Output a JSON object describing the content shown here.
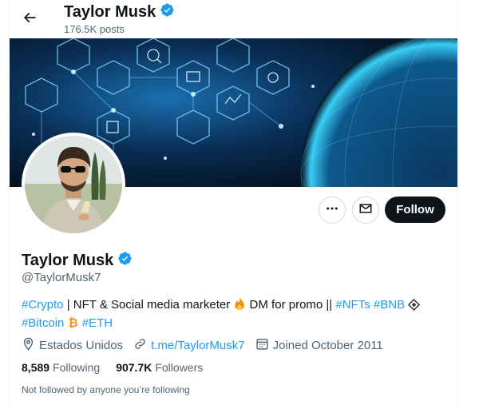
{
  "header": {
    "name": "Taylor Musk",
    "posts": "176.5K posts"
  },
  "actions": {
    "follow_label": "Follow"
  },
  "profile": {
    "name": "Taylor Musk",
    "handle": "@TaylorMusk7",
    "bio": {
      "tag_crypto": "#Crypto",
      "text1": " | NFT & Social media marketer ",
      "text2": " DM for promo || ",
      "tag_nfts": "#NFTs",
      "tag_bnb": "#BNB",
      "tag_bitcoin": "#Bitcoin",
      "tag_eth": "#ETH"
    },
    "location": "Estados Unidos",
    "link": "t.me/TaylorMusk7",
    "joined": "Joined October 2011",
    "following_count": "8,589",
    "following_label": "Following",
    "followers_count": "907.7K",
    "followers_label": "Followers",
    "not_followed": "Not followed by anyone you’re following"
  },
  "colors": {
    "accent": "#1d9bf0",
    "text": "#0f1419",
    "muted": "#536471",
    "verified": "#1d9bf0",
    "bitcoin": "#f7931a",
    "fire": "#f4900c",
    "bnb": "#3a3a3a"
  },
  "icons": [
    "back-arrow-icon",
    "verified-badge-icon",
    "more-icon",
    "mail-icon",
    "location-icon",
    "link-icon",
    "calendar-icon",
    "fire-emoji",
    "bnb-emoji",
    "bitcoin-emoji"
  ]
}
